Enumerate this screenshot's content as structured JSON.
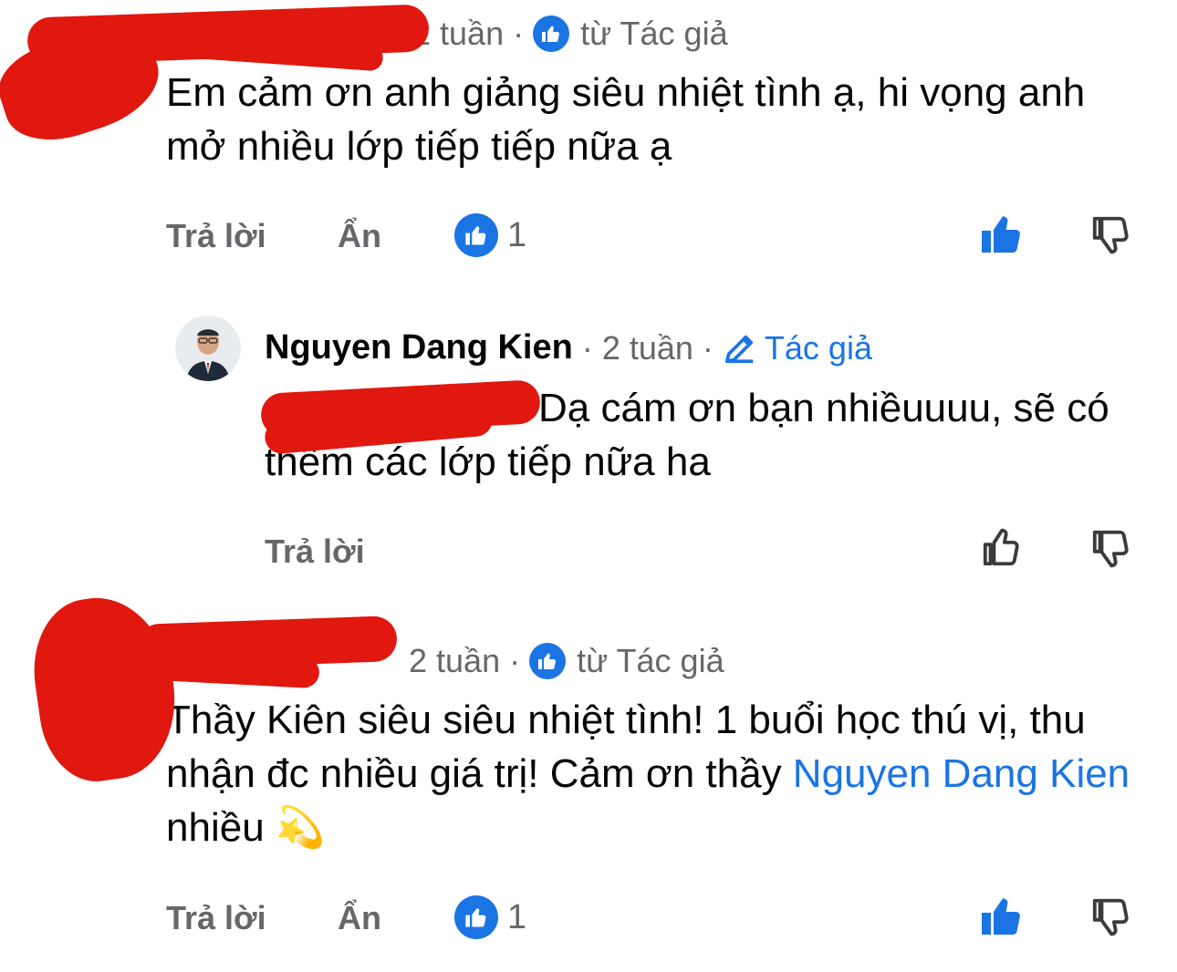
{
  "comments": [
    {
      "time": "2 tuần",
      "badge_text": "từ Tác giả",
      "text": "Em cảm ơn anh giảng siêu nhiệt tình ạ, hi vọng anh mở nhiều lớp tiếp tiếp nữa ạ",
      "actions": {
        "reply": "Trả lời",
        "hide": "Ẩn"
      },
      "like_count": "1",
      "liked": true
    },
    {
      "author": "Nguyen Dang Kien",
      "time": "2 tuần",
      "badge_text": "Tác giả",
      "text": "Dạ cám ơn bạn nhiềuuuu, sẽ có thêm các lớp tiếp nữa ha",
      "actions": {
        "reply": "Trả lời"
      },
      "liked": false
    },
    {
      "time": "2 tuần",
      "badge_text": "từ Tác giả",
      "text_before": "Thầy Kiên siêu siêu nhiệt tình! 1 buổi học thú vị, thu nhận đc nhiều giá trị! Cảm ơn thầy ",
      "mention": "Nguyen Dang Kien",
      "text_after": " nhiều ",
      "emoji": "💫",
      "actions": {
        "reply": "Trả lời",
        "hide": "Ẩn"
      },
      "like_count": "1",
      "liked": true
    }
  ],
  "colors": {
    "accent": "#1b74e4",
    "secondary_text": "#65676b",
    "redaction": "#e0180f"
  },
  "icons": [
    "like-badge-icon",
    "pencil-icon",
    "thumbs-up-icon",
    "thumbs-down-icon"
  ]
}
